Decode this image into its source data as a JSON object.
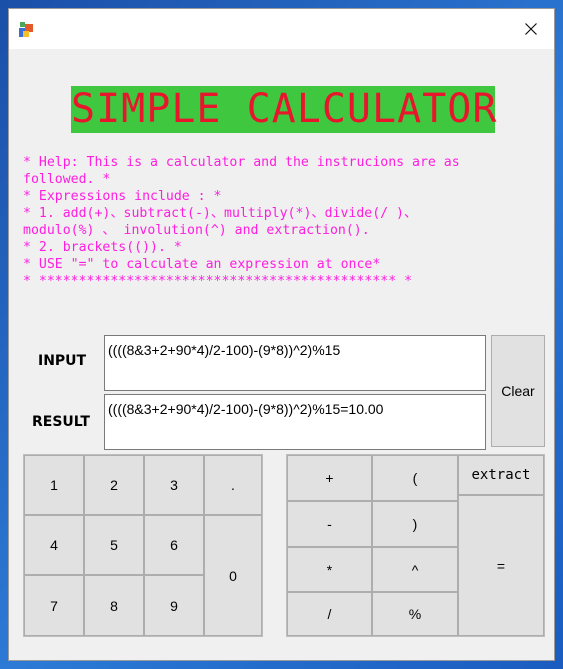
{
  "window": {
    "close_glyph": "✕"
  },
  "banner": {
    "title": "SIMPLE CALCULATOR",
    "background": "#3fc83f",
    "color": "#e8162c"
  },
  "help": {
    "color": "#ff1ee0",
    "text": "* Help: This is a calculator and the instrucions are as\nfollowed. *\n* Expressions include : *\n* 1. add(+)、subtract(-)、multiply(*)、divide(/ )、\nmodulo(%) 、 involution(^) and extraction().\n* 2. brackets(()). *\n* USE \"=\" to calculate an expression at once*\n* ********************************************* *"
  },
  "io": {
    "input_label": "INPUT",
    "result_label": "RESULT",
    "input_value": "((((8&3+2+90*4)/2-100)-(9*8))^2)%15",
    "result_value": "((((8&3+2+90*4)/2-100)-(9*8))^2)%15=10.00",
    "clear_label": "Clear"
  },
  "keypad": {
    "k1": "1",
    "k2": "2",
    "k3": "3",
    "kdot": ".",
    "k4": "4",
    "k5": "5",
    "k6": "6",
    "k0": "0",
    "k7": "7",
    "k8": "8",
    "k9": "9"
  },
  "operators": {
    "plus": "+",
    "lparen": "(",
    "extract": "extract",
    "minus": "-",
    "rparen": ")",
    "equals": "=",
    "multiply": "*",
    "power": "^",
    "divide": "/",
    "modulo": "%"
  }
}
